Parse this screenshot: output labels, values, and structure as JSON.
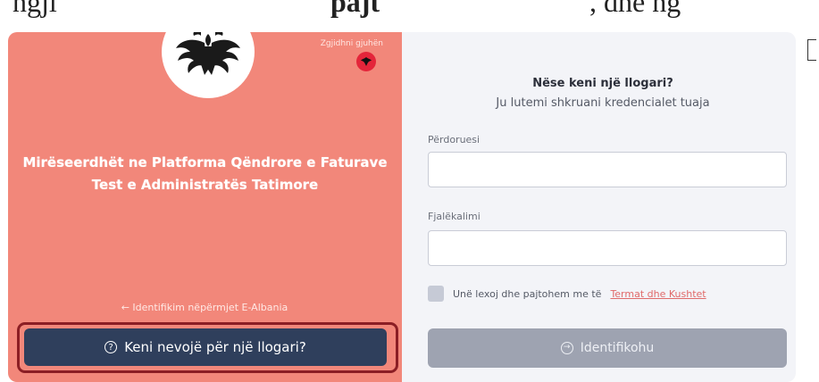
{
  "top_caption": {
    "part1": "ngji",
    "part2": "pajt",
    "part3": ", dhe ng"
  },
  "branding": {
    "language_link": "Zgjidhni gjuhën",
    "welcome": "Mirëseerdhët ne Platforma Qëndrore e Faturave Test e Administratës Tatimore",
    "ealbania_link": "← Identifikim nëpërmjet E-Albania",
    "account_button": "Keni nevojë për një llogari?"
  },
  "login": {
    "title": "Nëse keni një llogari?",
    "subtitle": "Ju lutemi shkruani kredencialet tuaja",
    "username_label": "Përdoruesi",
    "username_value": "",
    "password_label": "Fjalëkalimi",
    "password_value": "",
    "terms_text": "Unë lexoj dhe pajtohem me të",
    "terms_link": "Termat dhe Kushtet",
    "login_button": "Identifikohu"
  },
  "icons": {
    "emblem": "albanian-eagle-icon",
    "flag": "flag-icon",
    "help": "question-circle-icon",
    "login": "login-arrow-icon"
  },
  "colors": {
    "left_panel": "#f2877a",
    "account_button": "#2f3f5c",
    "login_button": "#9ea3b1",
    "highlight": "#8b1e24"
  }
}
